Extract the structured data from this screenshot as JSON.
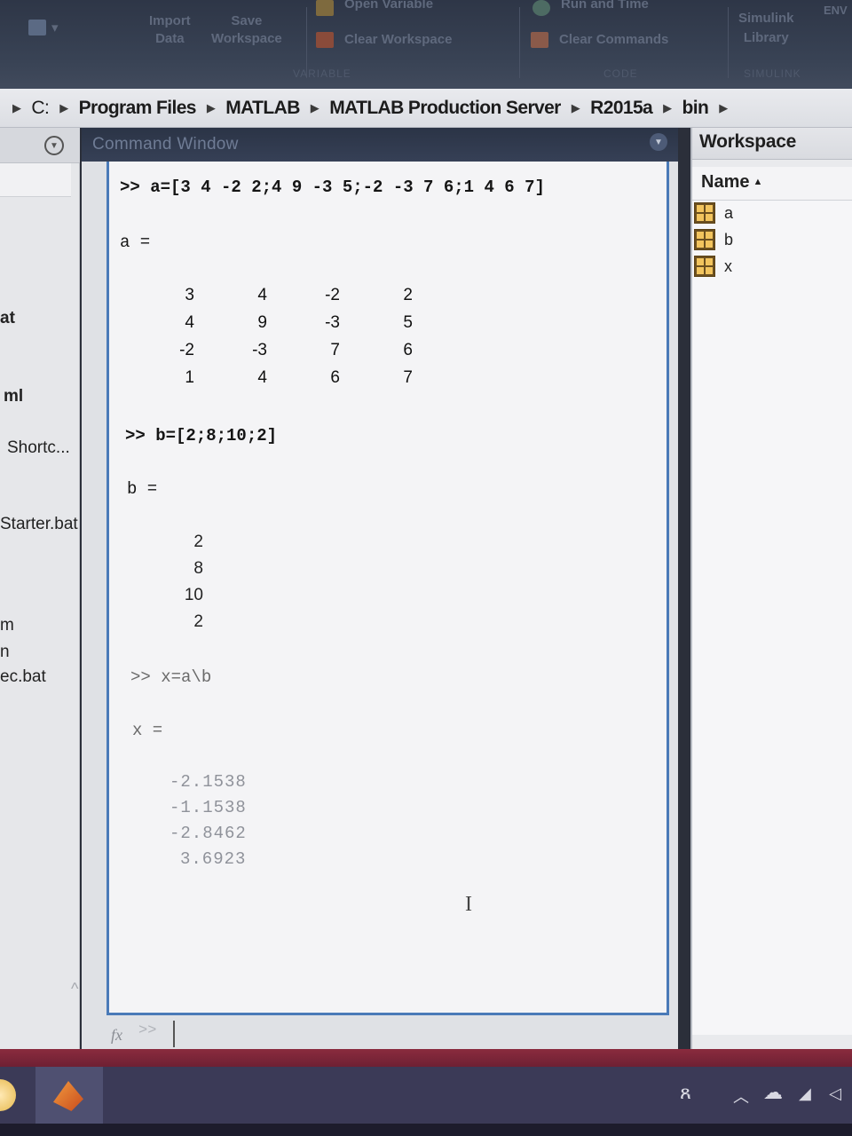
{
  "toolstrip": {
    "open_variable": "Open Variable",
    "import_data": [
      "Import",
      "Data"
    ],
    "save_workspace": [
      "Save",
      "Workspace"
    ],
    "clear_workspace": "Clear Workspace",
    "run_and_time": "Run and Time",
    "clear_commands": "Clear Commands",
    "simulink_library": [
      "Simulink",
      "Library"
    ],
    "env": "ENV",
    "sections": {
      "variable": "VARIABLE",
      "code": "CODE",
      "simulink": "SIMULINK"
    }
  },
  "address_bar": {
    "crumbs": [
      "C:",
      "Program Files",
      "MATLAB",
      "MATLAB Production Server",
      "R2015a",
      "bin"
    ]
  },
  "current_folder": {
    "items": [
      "at",
      "ml",
      "Shortc...",
      "Starter.bat",
      "m",
      "n",
      "ec.bat"
    ]
  },
  "command_window": {
    "title": "Command Window",
    "cmd_a": ">> a=[3 4 -2 2;4 9 -3 5;-2 -3 7 6;1 4 6 7]",
    "label_a": "a =",
    "matrix_a": [
      [
        "3",
        "4",
        "-2",
        "2"
      ],
      [
        "4",
        "9",
        "-3",
        "5"
      ],
      [
        "-2",
        "-3",
        "7",
        "6"
      ],
      [
        "1",
        "4",
        "6",
        "7"
      ]
    ],
    "cmd_b": ">> b=[2;8;10;2]",
    "label_b": "b =",
    "vector_b": [
      "2",
      "8",
      "10",
      "2"
    ],
    "cmd_x": ">> x=a\\b",
    "label_x": "x =",
    "vector_x": [
      "-2.1538",
      "-1.1538",
      "-2.8462",
      "3.6923"
    ],
    "fx": "fx",
    "prompt": ">>"
  },
  "workspace": {
    "title": "Workspace",
    "column_name": "Name",
    "sort_indicator": "▲",
    "variables": [
      "a",
      "b",
      "x"
    ]
  },
  "colors": {
    "accent_border": "#4a7ab8",
    "toolstrip_bg": "#394355",
    "taskbar_bg": "#3b3a57",
    "variable_icon": "#f2c45e"
  },
  "icons": {
    "collapse": "chevron-down-icon",
    "variable": "matrix-variable-icon",
    "fx": "function-icon"
  }
}
